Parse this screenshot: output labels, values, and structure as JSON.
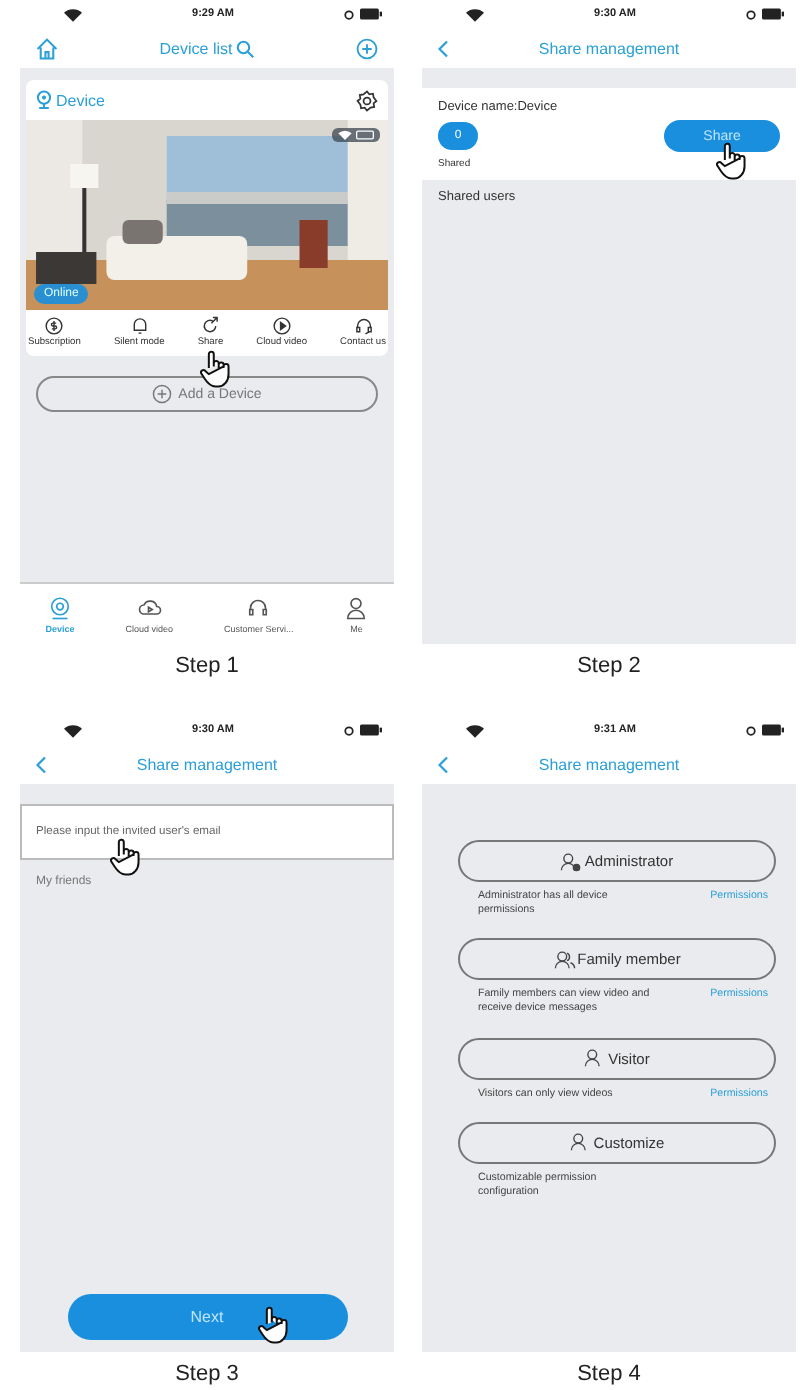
{
  "panels": [
    {
      "kind": "device_list",
      "time": "9:29 AM",
      "title": "Device list",
      "device": {
        "name": "Device",
        "status": "Online",
        "actions": [
          "Subscription",
          "Silent mode",
          "Share",
          "Cloud video",
          "Contact us"
        ]
      },
      "add_button": "Add a Device",
      "tabs": [
        {
          "label": "Device",
          "selected": true
        },
        {
          "label": "Cloud video",
          "selected": false
        },
        {
          "label": "Customer Servi...",
          "selected": false
        },
        {
          "label": "Me",
          "selected": false
        }
      ],
      "caption": "Step 1"
    },
    {
      "kind": "share_summary",
      "time": "9:30 AM",
      "title": "Share management",
      "device_name": "Device name:Device",
      "shared_count": "0",
      "shared_label": "Shared",
      "share_button": "Share",
      "section": "Shared users",
      "caption": "Step 2"
    },
    {
      "kind": "invite",
      "time": "9:30 AM",
      "title": "Share management",
      "email_field": {
        "placeholder": "Please input the invited user's email"
      },
      "friends_label": "My friends",
      "next_button": "Next",
      "caption": "Step 3"
    },
    {
      "kind": "roles",
      "time": "9:31 AM",
      "title": "Share management",
      "roles": [
        {
          "label": "Administrator",
          "description": "Administrator has all device permissions",
          "link": "Permissions"
        },
        {
          "label": "Family member",
          "description": "Family members can view video and receive device messages",
          "link": "Permissions"
        },
        {
          "label": "Visitor",
          "description": "Visitors can only view videos",
          "link": "Permissions"
        },
        {
          "label": "Customize",
          "description": "Customizable permission configuration"
        }
      ],
      "caption": "Step 4"
    }
  ]
}
